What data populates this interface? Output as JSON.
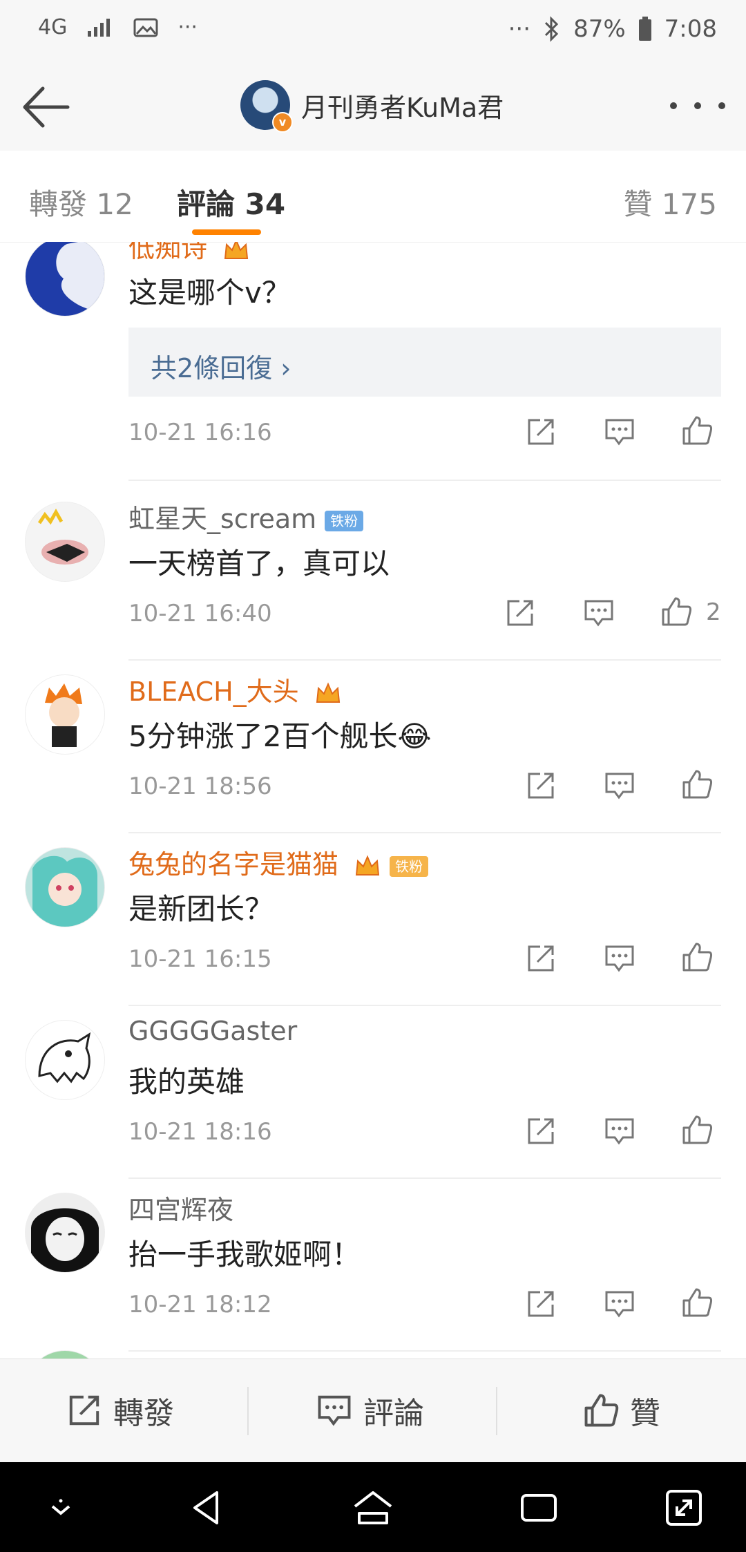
{
  "status": {
    "network": "4G",
    "battery": "87%",
    "time": "7:08",
    "dots": "···"
  },
  "header": {
    "title": "月刊勇者KuMa君",
    "badge": "v"
  },
  "tabs": [
    {
      "label": "轉發 12"
    },
    {
      "label": "評論 34"
    },
    {
      "label": "贊 175"
    }
  ],
  "comments": [
    {
      "name": "低痴诗",
      "text": "这是哪个v？",
      "replies": "共2條回復 ›",
      "time": "10-21 16:16",
      "likes": ""
    },
    {
      "name": "虹星天_scream",
      "fan": "铁粉",
      "text": "一天榜首了，真可以",
      "time": "10-21 16:40",
      "likes": "2"
    },
    {
      "name": "BLEACH_大头",
      "text": "5分钟涨了2百个舰长😂",
      "time": "10-21 18:56",
      "likes": ""
    },
    {
      "name": "兔兔的名字是猫猫",
      "fan": "铁粉",
      "text": "是新团长？",
      "time": "10-21 16:15",
      "likes": ""
    },
    {
      "name": "GGGGGaster",
      "text": "我的英雄",
      "time": "10-21 18:16",
      "likes": ""
    },
    {
      "name": "四宫辉夜",
      "text": "抬一手我歌姬啊！",
      "time": "10-21 18:12",
      "likes": ""
    }
  ],
  "bottom": {
    "repost": "轉發",
    "comment": "評論",
    "like": "贊"
  },
  "colors": {
    "accent": "#ff8200",
    "vip_name": "#e06b1a",
    "reply_link": "#4a6c93"
  }
}
